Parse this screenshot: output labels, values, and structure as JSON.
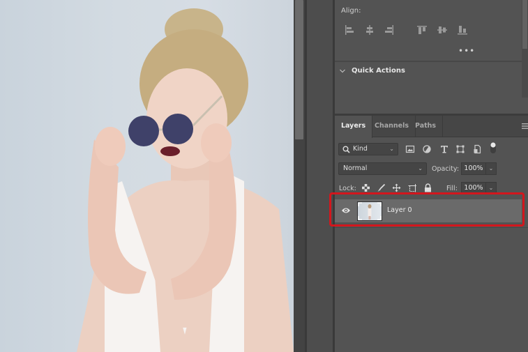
{
  "canvas": {
    "image_description": "woman-with-sunglasses-photo",
    "background_color": "#d3dbe2"
  },
  "properties": {
    "align_label": "Align:",
    "align_icons": [
      "align-left-edges-icon",
      "align-horizontal-centers-icon",
      "align-right-edges-icon",
      "align-top-edges-icon",
      "align-vertical-centers-icon",
      "align-bottom-edges-icon"
    ],
    "more_label": "•••",
    "quick_actions_label": "Quick Actions"
  },
  "layers_panel": {
    "tabs": [
      {
        "label": "Layers",
        "active": true
      },
      {
        "label": "Channels",
        "active": false
      },
      {
        "label": "Paths",
        "active": false
      }
    ],
    "filter": {
      "kind_label": "Kind",
      "filter_icons": [
        "pixel-layer-filter-icon",
        "adjustment-layer-filter-icon",
        "type-layer-filter-icon",
        "shape-layer-filter-icon",
        "smart-object-filter-icon",
        "filter-toggle-icon"
      ]
    },
    "blend_mode": "Normal",
    "opacity_label": "Opacity:",
    "opacity_value": "100%",
    "lock_label": "Lock:",
    "lock_icons": [
      "lock-transparent-pixels-icon",
      "lock-image-pixels-icon",
      "lock-position-icon",
      "lock-artboard-icon",
      "lock-all-icon"
    ],
    "fill_label": "Fill:",
    "fill_value": "100%",
    "layers": [
      {
        "name": "Layer 0",
        "visible": true,
        "selected": true
      }
    ]
  },
  "colors": {
    "panel_bg": "#535353",
    "selected_layer_bg": "#6a6a6a",
    "highlight_red": "#d3161d"
  }
}
